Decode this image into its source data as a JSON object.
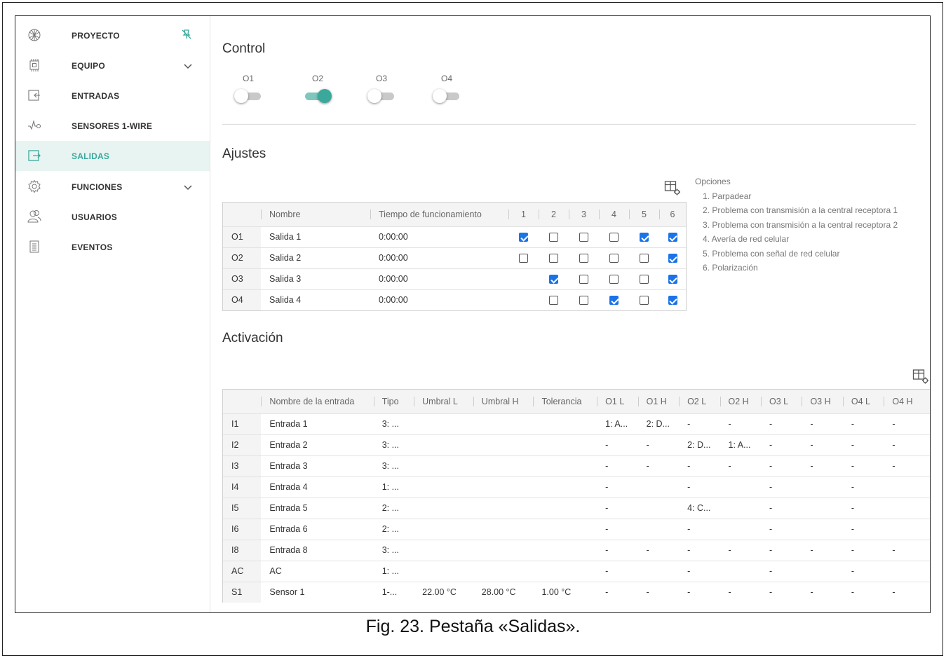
{
  "sidebar": {
    "items": [
      {
        "label": "PROYECTO",
        "icon": "project-icon"
      },
      {
        "label": "EQUIPO",
        "icon": "chip-icon"
      },
      {
        "label": "ENTRADAS",
        "icon": "input-icon"
      },
      {
        "label": "SENSORES 1-WIRE",
        "icon": "sensor-wave-icon"
      },
      {
        "label": "SALIDAS",
        "icon": "output-icon"
      },
      {
        "label": "FUNCIONES",
        "icon": "gear-icon"
      },
      {
        "label": "USUARIOS",
        "icon": "users-icon"
      },
      {
        "label": "EVENTOS",
        "icon": "document-icon"
      }
    ],
    "active_item": "SALIDAS",
    "accent_color": "#3aa99b"
  },
  "control": {
    "title": "Control",
    "toggles": [
      {
        "label": "O1",
        "on": false
      },
      {
        "label": "O2",
        "on": true
      },
      {
        "label": "O3",
        "on": false
      },
      {
        "label": "O4",
        "on": false
      }
    ]
  },
  "ajustes": {
    "title": "Ajustes",
    "headers": [
      "",
      "Nombre",
      "Tiempo de funcionamiento",
      "1",
      "2",
      "3",
      "4",
      "5",
      "6"
    ],
    "rows": [
      {
        "id": "O1",
        "name": "Salida 1",
        "time": "0:00:00",
        "opts": [
          true,
          false,
          false,
          false,
          true,
          true
        ]
      },
      {
        "id": "O2",
        "name": "Salida 2",
        "time": "0:00:00",
        "opts": [
          false,
          false,
          false,
          false,
          false,
          true
        ]
      },
      {
        "id": "O3",
        "name": "Salida 3",
        "time": "0:00:00",
        "opts": [
          null,
          true,
          false,
          false,
          false,
          true
        ]
      },
      {
        "id": "O4",
        "name": "Salida 4",
        "time": "0:00:00",
        "opts": [
          null,
          false,
          false,
          true,
          false,
          true
        ]
      }
    ],
    "options_title": "Opciones",
    "options": [
      "1. Parpadear",
      "2. Problema con transmisión a la central receptora 1",
      "3. Problema con transmisión a la central receptora 2",
      "4. Avería de red celular",
      "5. Problema con señal de red celular",
      "6. Polarización"
    ]
  },
  "activacion": {
    "title": "Activación",
    "headers": [
      "",
      "Nombre de la entrada",
      "Tipo",
      "Umbral L",
      "Umbral H",
      "Tolerancia",
      "O1 L",
      "O1 H",
      "O2 L",
      "O2 H",
      "O3 L",
      "O3 H",
      "O4 L",
      "O4 H"
    ],
    "rows": [
      [
        "I1",
        "Entrada 1",
        "3: ...",
        "",
        "",
        "",
        "1: A...",
        "2: D...",
        "-",
        "-",
        "-",
        "-",
        "-",
        "-"
      ],
      [
        "I2",
        "Entrada 2",
        "3: ...",
        "",
        "",
        "",
        "-",
        "-",
        "2: D...",
        "1: A...",
        "-",
        "-",
        "-",
        "-"
      ],
      [
        "I3",
        "Entrada 3",
        "3: ...",
        "",
        "",
        "",
        "-",
        "-",
        "-",
        "-",
        "-",
        "-",
        "-",
        "-"
      ],
      [
        "I4",
        "Entrada 4",
        "1: ...",
        "",
        "",
        "",
        "-",
        "",
        "-",
        "",
        "-",
        "",
        "-",
        ""
      ],
      [
        "I5",
        "Entrada 5",
        "2: ...",
        "",
        "",
        "",
        "-",
        "",
        "4: C...",
        "",
        "-",
        "",
        "-",
        ""
      ],
      [
        "I6",
        "Entrada 6",
        "2: ...",
        "",
        "",
        "",
        "-",
        "",
        "-",
        "",
        "-",
        "",
        "-",
        ""
      ],
      [
        "I8",
        "Entrada 8",
        "3: ...",
        "",
        "",
        "",
        "-",
        "-",
        "-",
        "-",
        "-",
        "-",
        "-",
        "-"
      ],
      [
        "AC",
        "AC",
        "1: ...",
        "",
        "",
        "",
        "-",
        "",
        "-",
        "",
        "-",
        "",
        "-",
        ""
      ],
      [
        "S1",
        "Sensor 1",
        "1-...",
        "22.00 °C",
        "28.00 °C",
        "1.00 °C",
        "-",
        "-",
        "-",
        "-",
        "-",
        "-",
        "-",
        "-"
      ]
    ]
  },
  "caption": "Fig. 23. Pestaña «Salidas».",
  "colors": {
    "accent": "#3aa99b",
    "checkbox": "#1a73e8",
    "active_bg": "#e8f4f2"
  }
}
